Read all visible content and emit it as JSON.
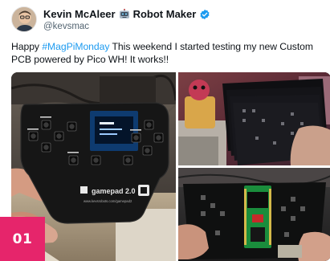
{
  "post": {
    "author": {
      "display_name": "Kevin McAleer",
      "title_suffix": "Robot Maker",
      "handle": "@kevsmac",
      "robot_icon": "robot-face-icon",
      "verified_icon": "verified-badge-icon",
      "verified_color": "#1d9bf0"
    },
    "text_before": "Happy ",
    "hashtag": "#MagPiMonday",
    "text_after": " This weekend I started testing my new Custom PCB powered by Pico WH! It works!!",
    "hashtag_color": "#1d9bf0",
    "media": {
      "main_board_label": "gamepad 2.0",
      "main_board_url": "www.kevsrobots.com/gamepad2",
      "photo_count": 3
    }
  },
  "figure_number": "01",
  "badge_color": "#e6256b"
}
